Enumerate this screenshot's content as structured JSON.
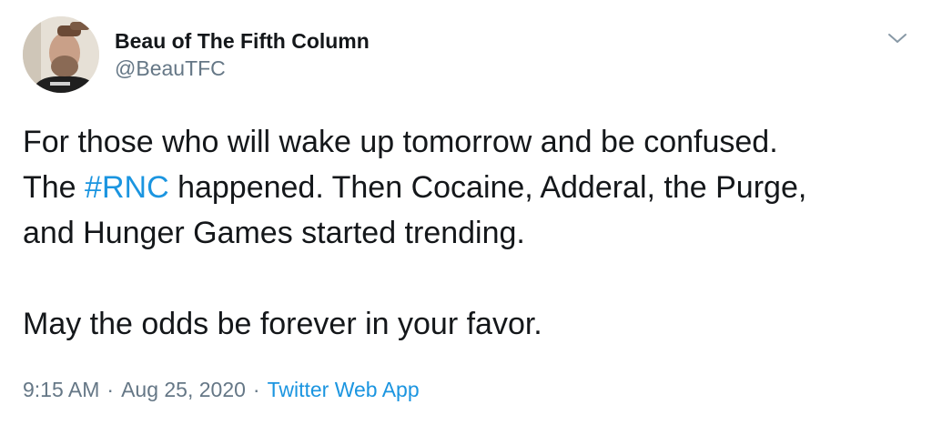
{
  "author": {
    "display_name": "Beau of The Fifth Column",
    "handle": "@BeauTFC"
  },
  "menu": {
    "icon": "chevron-down-icon"
  },
  "tweet": {
    "line1": "For those who will wake up tomorrow and be confused.",
    "line2_prefix": "The ",
    "hashtag": "#RNC",
    "line2_suffix": " happened. Then Cocaine, Adderal, the Purge,",
    "line3": "and Hunger Games started trending.",
    "line4": "May the odds be forever in your favor."
  },
  "meta": {
    "time": "9:15 AM",
    "separator": "·",
    "date": "Aug 25, 2020",
    "source": "Twitter Web App"
  },
  "colors": {
    "text": "#14171a",
    "secondary": "#657786",
    "link": "#1b95e0"
  }
}
